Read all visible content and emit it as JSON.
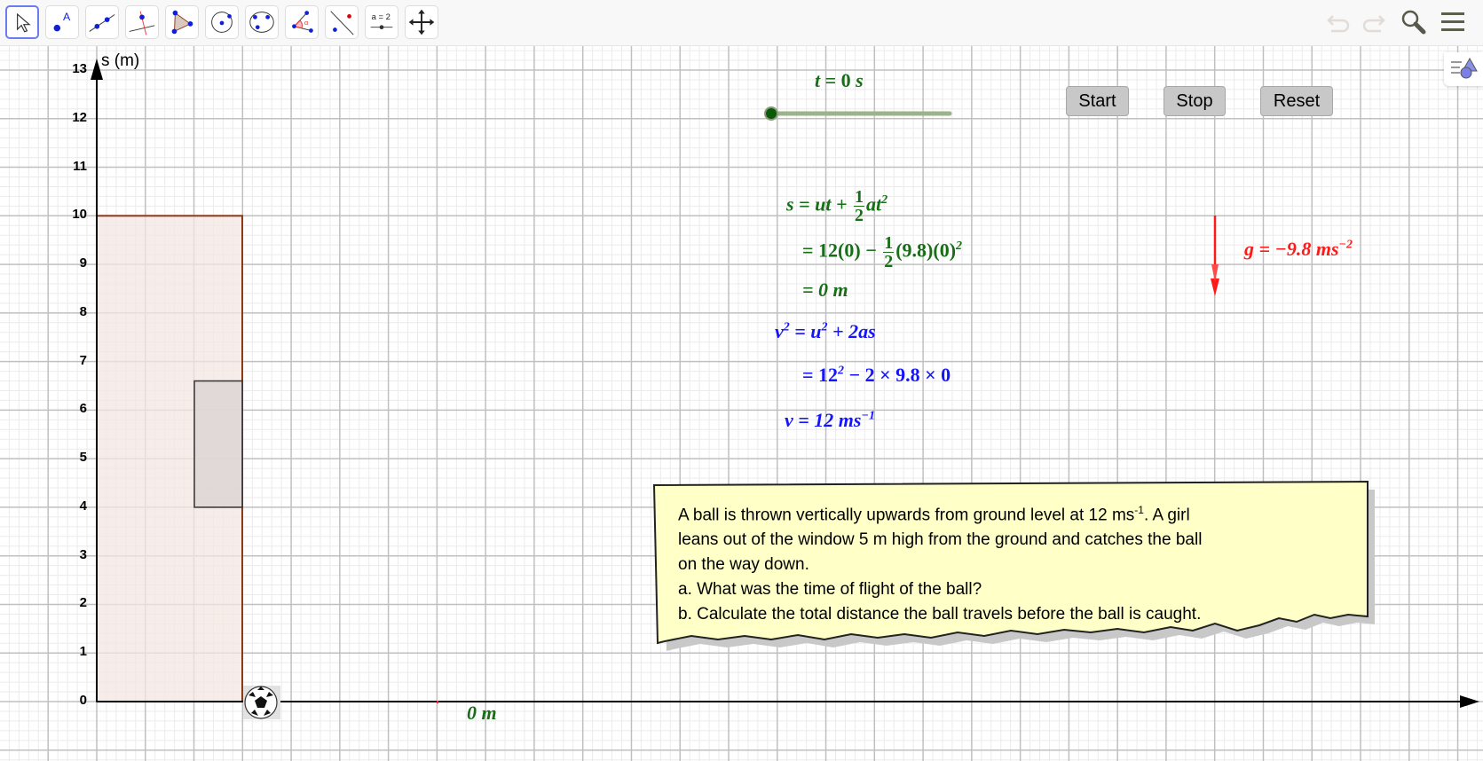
{
  "toolbar": {
    "tools": [
      {
        "name": "move-tool",
        "selected": true
      },
      {
        "name": "point-tool"
      },
      {
        "name": "line-tool"
      },
      {
        "name": "perpendicular-line-tool"
      },
      {
        "name": "polygon-tool"
      },
      {
        "name": "circle-center-point-tool"
      },
      {
        "name": "conic-five-points-tool"
      },
      {
        "name": "angle-tool"
      },
      {
        "name": "reflect-about-line-tool"
      },
      {
        "name": "slider-tool",
        "label": "a = 2"
      },
      {
        "name": "move-graphics-view-tool"
      }
    ],
    "right_icons": [
      "undo-icon",
      "redo-icon",
      "search-icon",
      "menu-icon"
    ]
  },
  "graph": {
    "y_axis_label": "s (m)",
    "y_ticks": [
      "0",
      "1",
      "2",
      "3",
      "4",
      "5",
      "6",
      "7",
      "8",
      "9",
      "10",
      "11",
      "12",
      "13"
    ],
    "y_range": [
      0,
      13
    ],
    "grid": true,
    "building": {
      "height_m": 10,
      "fill": "#f3e6e2",
      "stroke": "#8b3a14"
    },
    "window": {
      "bottom_m": 4,
      "top_m": 6.6,
      "fill": "#dcd4d2",
      "stroke": "#333333"
    },
    "ball_icon": "soccer-ball-icon",
    "position_label": "0 m"
  },
  "slider": {
    "label_var": "t",
    "label_eq": " = ",
    "label_value": "0",
    "label_unit": " s",
    "value": 0,
    "color": "#9db38a"
  },
  "buttons": {
    "start": "Start",
    "stop": "Stop",
    "reset": "Reset"
  },
  "equations": {
    "s1": {
      "lhs": "s = ut + ",
      "num": "1",
      "den": "2",
      "tail": "at",
      "sup": "2"
    },
    "s2": {
      "pre": "= 12(0) − ",
      "num": "1",
      "den": "2",
      "tail": "(9.8)(0)",
      "sup": "2"
    },
    "s3": "= 0 m",
    "v1": {
      "a": "v",
      "a_sup": "2",
      "b": " = u",
      "b_sup": "2",
      "c": " + 2as"
    },
    "v2": {
      "a": "= 12",
      "a_sup": "2",
      "b": " − 2 × 9.8 × 0"
    },
    "v3": {
      "a": "v = 12 ms",
      "a_sup": "−1"
    },
    "g": {
      "a": "g = −9.8 ms",
      "a_sup": "−2"
    },
    "colors": {
      "displacement": "#176e17",
      "velocity": "#1414ff",
      "gravity": "#ff1a1a"
    }
  },
  "note": {
    "line1_pre": "A ball is thrown vertically upwards from ground level at 12 ms",
    "line1_sup": "-1",
    "line1_post": ". A girl",
    "line2": "leans out of the window 5 m high from the ground and catches the ball",
    "line3": "on the way down.",
    "line4": "a.  What was the time of flight of the ball?",
    "line5": "b.  Calculate the total distance the ball travels before the ball is caught.",
    "background": "#ffffc8"
  }
}
